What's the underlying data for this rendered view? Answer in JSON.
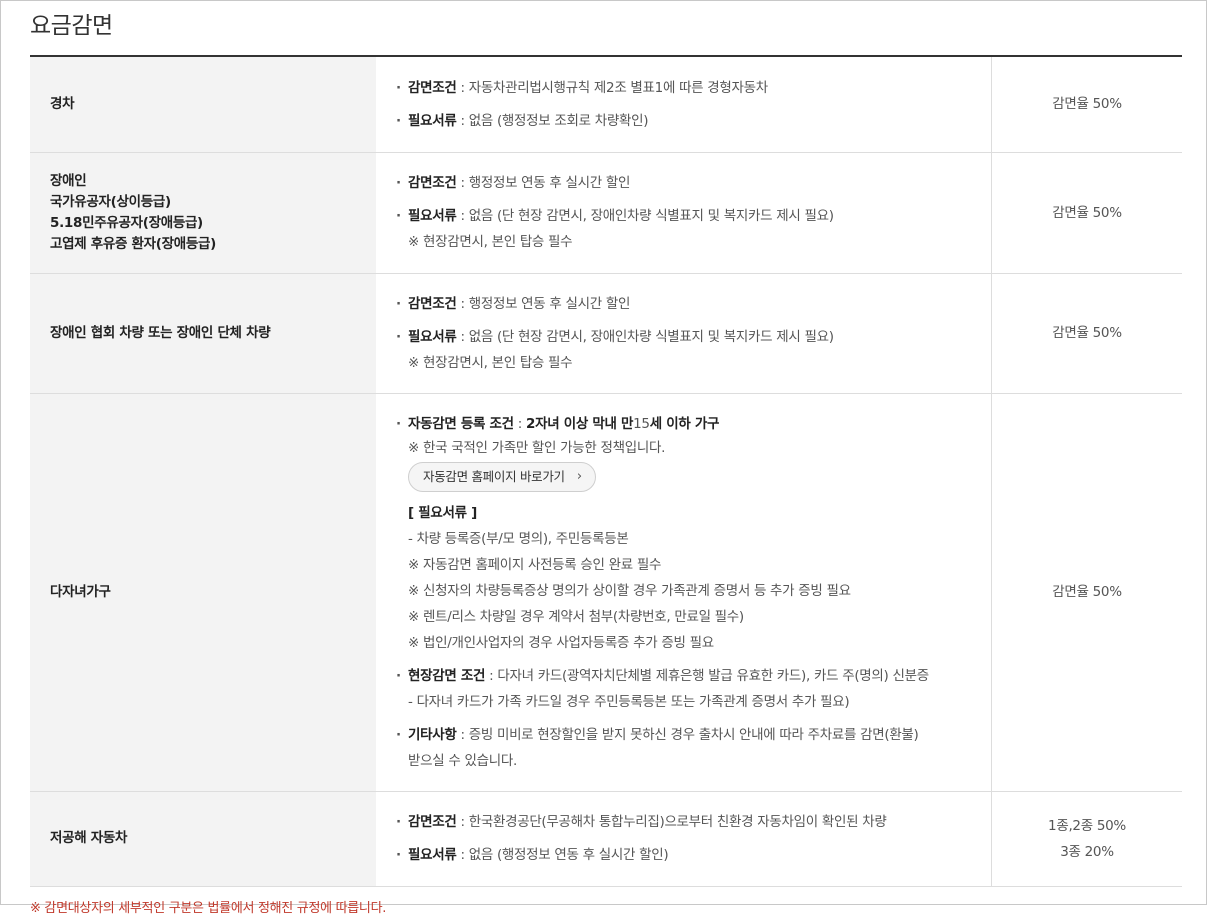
{
  "page": {
    "title": "요금감면",
    "footnote": "※ 감면대상자의 세부적인 구분은 법률에서 정해진 규정에 따릅니다."
  },
  "rows": [
    {
      "category_lines": [
        "경차"
      ],
      "items": [
        {
          "label": "감면조건",
          "text": " : 자동차관리법시행규칙 제2조 별표1에 따른 경형자동차"
        },
        {
          "label": "필요서류",
          "text": " : 없음 (행정정보 조회로 차량확인)"
        }
      ],
      "rate_lines": [
        "감면율 50%"
      ]
    },
    {
      "category_lines": [
        "장애인",
        "국가유공자(상이등급)",
        "5.18민주유공자(장애등급)",
        "고엽제 후유증 환자(장애등급)"
      ],
      "items": [
        {
          "label": "감면조건",
          "text": " : 행정정보 연동 후 실시간 할인"
        },
        {
          "label": "필요서류",
          "text": " : 없음 (단 현장 감면시, 장애인차량 식별표지 및 복지카드 제시 필요)",
          "note": "※ 현장감면시, 본인 탑승 필수"
        }
      ],
      "rate_lines": [
        "감면율 50%"
      ]
    },
    {
      "category_lines": [
        "장애인 협회 차량 또는 장애인 단체 차량"
      ],
      "items": [
        {
          "label": "감면조건",
          "text": " : 행정정보 연동 후 실시간 할인"
        },
        {
          "label": "필요서류",
          "text": " : 없음 (단 현장 감면시, 장애인차량 식별표지 및 복지카드 제시 필요)",
          "note": "※ 현장감면시, 본인 탑승 필수"
        }
      ],
      "rate_lines": [
        "감면율 50%"
      ]
    },
    {
      "category_lines": [
        "다자녀가구"
      ],
      "auto": {
        "label": "자동감면 등록 조건",
        "prefix": " : ",
        "bold_1": "2자녀 이상 막내 만",
        "num": "15",
        "bold_2": "세 이하 가구",
        "note": "※ 한국 국적인 가족만 할인 가능한 정책입니다.",
        "button": "자동감면 홈페이지 바로가기",
        "button_icon": "›"
      },
      "docs_header": "[ 필요서류 ]",
      "docs": [
        "- 차량 등록증(부/모 명의), 주민등록등본",
        "※ 자동감면 홈페이지 사전등록 승인 완료 필수",
        "※ 신청자의 차량등록증상 명의가 상이할 경우 가족관계 증명서 등 추가 증빙 필요",
        "※ 렌트/리스 차량일 경우 계약서 첨부(차량번호, 만료일 필수)",
        "※ 법인/개인사업자의 경우 사업자등록증 추가 증빙 필요"
      ],
      "onsite": {
        "label": "현장감면 조건",
        "text": " : 다자녀 카드(광역자치단체별 제휴은행 발급 유효한 카드), 카드 주(명의) 신분증",
        "note": "- 다자녀 카드가 가족 카드일 경우 주민등록등본 또는 가족관계 증명서 추가 필요)"
      },
      "etc": {
        "label": "기타사항",
        "text": " : 증빙 미비로 현장할인을 받지 못하신 경우 출차시 안내에 따라 주차료를 감면(환불)",
        "note": "받으실 수 있습니다."
      },
      "rate_lines": [
        "감면율 50%"
      ]
    },
    {
      "category_lines": [
        "저공해 자동차"
      ],
      "items": [
        {
          "label": "감면조건",
          "text": " : 한국환경공단(무공해차 통합누리집)으로부터 친환경 자동차임이 확인된 차량"
        },
        {
          "label": "필요서류",
          "text": " : 없음 (행정정보 연동 후 실시간 할인)"
        }
      ],
      "rate_lines": [
        "1종,2종 50%",
        "3종 20%"
      ]
    }
  ]
}
